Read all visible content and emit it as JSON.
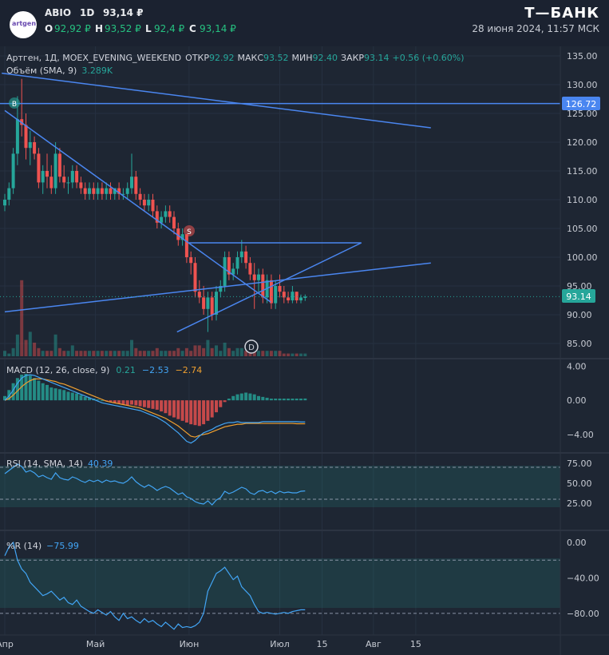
{
  "header": {
    "ticker": "ABIO",
    "interval": "1D",
    "price": "93,14 ₽",
    "logo_text": "artgen",
    "o_label": "O",
    "o_value": "92,92 ₽",
    "h_label": "H",
    "h_value": "93,52 ₽",
    "l_label": "L",
    "l_value": "92,4 ₽",
    "c_label": "C",
    "c_value": "93,14 ₽",
    "brand": "Т—БАНК",
    "datetime": "28 июня 2024, 11:57 МСК"
  },
  "legend": {
    "main_prefix": "Артген, 1Д, MOEX_EVENING_WEEKEND",
    "open_label": "ОТКР",
    "open_value": "92.92",
    "high_label": "МАКС",
    "high_value": "93.52",
    "low_label": "МИН",
    "low_value": "92.40",
    "close_label": "ЗАКР",
    "close_value": "93.14",
    "change": "+0.56 (+0.60%)",
    "volume_label": "Объём (SMA, 9)",
    "volume_value": "3.289K",
    "macd_label": "MACD (12, 26, close, 9)",
    "macd_v1": "0.21",
    "macd_v2": "−2.53",
    "macd_v3": "−2.74",
    "rsi_label": "RSI (14, SMA, 14)",
    "rsi_value": "40.39",
    "wr_label": "%R (14)",
    "wr_value": "−75.99"
  },
  "price_axis": [
    "135.00",
    "130.00",
    "125.00",
    "120.00",
    "115.00",
    "110.00",
    "105.00",
    "100.00",
    "95.00",
    "90.00",
    "85.00"
  ],
  "price_tags": {
    "level": "126.72",
    "last": "93.14"
  },
  "macd_axis": [
    "4.00",
    "0.00",
    "−4.00"
  ],
  "rsi_axis": [
    "75.00",
    "50.00",
    "25.00"
  ],
  "wr_axis": [
    "0.00",
    "−40.00",
    "−80.00"
  ],
  "time_axis": [
    "Апр",
    "Май",
    "Июн",
    "Июл",
    "15",
    "Авг",
    "15"
  ],
  "markers": {
    "b": "B",
    "s": "S",
    "d": "D"
  },
  "colors": {
    "bg": "#1e2633",
    "up": "#26a69a",
    "down": "#ef5350",
    "line": "#4a86f0",
    "rsi": "#42a5f5",
    "signal": "#f0a030"
  },
  "chart_data": {
    "type": "candlestick",
    "symbol": "ABIO",
    "ylim": [
      83,
      137
    ],
    "candles": [
      {
        "o": 109,
        "h": 111,
        "l": 108,
        "c": 110
      },
      {
        "o": 110,
        "h": 113,
        "l": 109,
        "c": 112
      },
      {
        "o": 112,
        "h": 119,
        "l": 111,
        "c": 118
      },
      {
        "o": 118,
        "h": 128,
        "l": 116,
        "c": 124
      },
      {
        "o": 124,
        "h": 131,
        "l": 121,
        "c": 123
      },
      {
        "o": 123,
        "h": 125,
        "l": 117,
        "c": 119
      },
      {
        "o": 119,
        "h": 122,
        "l": 116,
        "c": 120
      },
      {
        "o": 120,
        "h": 121,
        "l": 117,
        "c": 118
      },
      {
        "o": 118,
        "h": 119,
        "l": 112,
        "c": 113
      },
      {
        "o": 113,
        "h": 116,
        "l": 111,
        "c": 115
      },
      {
        "o": 115,
        "h": 118,
        "l": 112,
        "c": 114
      },
      {
        "o": 114,
        "h": 116,
        "l": 111,
        "c": 112
      },
      {
        "o": 112,
        "h": 120,
        "l": 111,
        "c": 118
      },
      {
        "o": 118,
        "h": 119,
        "l": 113,
        "c": 114
      },
      {
        "o": 114,
        "h": 116,
        "l": 112,
        "c": 113
      },
      {
        "o": 113,
        "h": 114,
        "l": 111,
        "c": 113
      },
      {
        "o": 113,
        "h": 116,
        "l": 112,
        "c": 115
      },
      {
        "o": 115,
        "h": 116,
        "l": 112,
        "c": 113
      },
      {
        "o": 113,
        "h": 114,
        "l": 111,
        "c": 112
      },
      {
        "o": 112,
        "h": 113,
        "l": 110,
        "c": 111
      },
      {
        "o": 111,
        "h": 113,
        "l": 110,
        "c": 112
      },
      {
        "o": 112,
        "h": 113,
        "l": 110,
        "c": 111
      },
      {
        "o": 111,
        "h": 113,
        "l": 110,
        "c": 112
      },
      {
        "o": 112,
        "h": 113,
        "l": 110,
        "c": 111
      },
      {
        "o": 111,
        "h": 113,
        "l": 110,
        "c": 112
      },
      {
        "o": 112,
        "h": 113,
        "l": 110,
        "c": 111
      },
      {
        "o": 111,
        "h": 112,
        "l": 110,
        "c": 112
      },
      {
        "o": 112,
        "h": 113,
        "l": 110,
        "c": 111
      },
      {
        "o": 111,
        "h": 112,
        "l": 110,
        "c": 111
      },
      {
        "o": 111,
        "h": 113,
        "l": 110,
        "c": 112
      },
      {
        "o": 112,
        "h": 118,
        "l": 111,
        "c": 114
      },
      {
        "o": 114,
        "h": 115,
        "l": 110,
        "c": 111
      },
      {
        "o": 111,
        "h": 112,
        "l": 109,
        "c": 110
      },
      {
        "o": 110,
        "h": 111,
        "l": 108,
        "c": 109
      },
      {
        "o": 109,
        "h": 111,
        "l": 108,
        "c": 110
      },
      {
        "o": 110,
        "h": 111,
        "l": 107,
        "c": 108
      },
      {
        "o": 108,
        "h": 109,
        "l": 105,
        "c": 106
      },
      {
        "o": 106,
        "h": 108,
        "l": 105,
        "c": 107
      },
      {
        "o": 107,
        "h": 109,
        "l": 106,
        "c": 108
      },
      {
        "o": 108,
        "h": 109,
        "l": 106,
        "c": 107
      },
      {
        "o": 107,
        "h": 108,
        "l": 104,
        "c": 105
      },
      {
        "o": 105,
        "h": 106,
        "l": 102,
        "c": 103
      },
      {
        "o": 103,
        "h": 105,
        "l": 102,
        "c": 104
      },
      {
        "o": 104,
        "h": 104,
        "l": 99,
        "c": 100
      },
      {
        "o": 100,
        "h": 101,
        "l": 97,
        "c": 99
      },
      {
        "o": 99,
        "h": 100,
        "l": 93,
        "c": 94
      },
      {
        "o": 94,
        "h": 96,
        "l": 92,
        "c": 93
      },
      {
        "o": 93,
        "h": 95,
        "l": 90,
        "c": 91
      },
      {
        "o": 91,
        "h": 94,
        "l": 87,
        "c": 93
      },
      {
        "o": 93,
        "h": 94,
        "l": 89,
        "c": 90
      },
      {
        "o": 90,
        "h": 95,
        "l": 89,
        "c": 94
      },
      {
        "o": 94,
        "h": 96,
        "l": 93,
        "c": 95
      },
      {
        "o": 95,
        "h": 101,
        "l": 94,
        "c": 100
      },
      {
        "o": 100,
        "h": 101,
        "l": 96,
        "c": 97
      },
      {
        "o": 97,
        "h": 99,
        "l": 96,
        "c": 98
      },
      {
        "o": 98,
        "h": 101,
        "l": 97,
        "c": 100
      },
      {
        "o": 100,
        "h": 103,
        "l": 99,
        "c": 101
      },
      {
        "o": 101,
        "h": 102,
        "l": 98,
        "c": 99
      },
      {
        "o": 99,
        "h": 100,
        "l": 96,
        "c": 97
      },
      {
        "o": 97,
        "h": 99,
        "l": 91,
        "c": 96
      },
      {
        "o": 96,
        "h": 98,
        "l": 94,
        "c": 97
      },
      {
        "o": 97,
        "h": 98,
        "l": 92,
        "c": 93
      },
      {
        "o": 93,
        "h": 97,
        "l": 92,
        "c": 96
      },
      {
        "o": 96,
        "h": 97,
        "l": 91,
        "c": 92
      },
      {
        "o": 92,
        "h": 96,
        "l": 91,
        "c": 95
      },
      {
        "o": 95,
        "h": 97,
        "l": 93,
        "c": 94
      },
      {
        "o": 94,
        "h": 95,
        "l": 92,
        "c": 93
      },
      {
        "o": 93,
        "h": 94,
        "l": 92,
        "c": 92.5
      },
      {
        "o": 92.5,
        "h": 95,
        "l": 92,
        "c": 94
      },
      {
        "o": 94,
        "h": 94,
        "l": 92,
        "c": 92.5
      },
      {
        "o": 92.5,
        "h": 93.5,
        "l": 92,
        "c": 93
      },
      {
        "o": 92.92,
        "h": 93.52,
        "l": 92.4,
        "c": 93.14
      }
    ],
    "volume": [
      2,
      1,
      3,
      8,
      28,
      6,
      9,
      5,
      3,
      2,
      2,
      2,
      8,
      3,
      2,
      2,
      4,
      2,
      2,
      2,
      2,
      2,
      2,
      2,
      2,
      2,
      2,
      2,
      2,
      2,
      6,
      3,
      2,
      2,
      2,
      2,
      3,
      2,
      2,
      2,
      2,
      3,
      2,
      3,
      2,
      4,
      4,
      3,
      6,
      3,
      4,
      2,
      5,
      3,
      2,
      3,
      3,
      2,
      2,
      2,
      2,
      2,
      2,
      2,
      2,
      2,
      1,
      1,
      1,
      1,
      1,
      1
    ],
    "trendlines": [
      {
        "from": {
          "x": "2024-04-01",
          "y": 125.5
        },
        "to": {
          "x": "2024-06-28",
          "y": 92.2
        }
      },
      {
        "from": {
          "x": "2024-04-01",
          "y": 90.5
        },
        "to": {
          "x": "2024-08-20",
          "y": 99
        }
      },
      {
        "from": {
          "x": "2024-06-01",
          "y": 102.5
        },
        "to": {
          "x": "2024-07-28",
          "y": 102.5
        }
      },
      {
        "from": {
          "x": "2024-05-28",
          "y": 87
        },
        "to": {
          "x": "2024-07-28",
          "y": 102.5
        }
      },
      {
        "from": {
          "x": "2024-03-31",
          "y": 132
        },
        "to": {
          "x": "2024-08-20",
          "y": 122.5
        }
      }
    ],
    "horizontal_level": 126.72,
    "last_price": 93.14,
    "macd": {
      "ylim": [
        -5.5,
        4.5
      ],
      "hist": [
        0.5,
        1.2,
        2,
        2.6,
        3,
        3.1,
        2.9,
        2.6,
        2.3,
        2,
        1.8,
        1.5,
        1.4,
        1.3,
        1.2,
        1.0,
        0.9,
        0.8,
        0.6,
        0.4,
        0.3,
        0.2,
        0.1,
        0,
        -0.1,
        -0.2,
        -0.3,
        -0.4,
        -0.5,
        -0.6,
        -0.5,
        -0.6,
        -0.7,
        -0.8,
        -0.9,
        -1,
        -1.1,
        -1.3,
        -1.5,
        -1.8,
        -2,
        -2.2,
        -2.4,
        -2.6,
        -2.8,
        -2.9,
        -3,
        -2.8,
        -2.4,
        -2,
        -1.4,
        -0.8,
        -0.2,
        0.2,
        0.5,
        0.7,
        0.8,
        0.9,
        0.8,
        0.7,
        0.5,
        0.4,
        0.3,
        0.2,
        0.2,
        0.2,
        0.2,
        0.2,
        0.2,
        0.2,
        0.2,
        0.21
      ],
      "macd_line": [
        0,
        0.5,
        1.2,
        2,
        2.6,
        2.9,
        3,
        2.9,
        2.7,
        2.5,
        2.3,
        2.1,
        1.9,
        1.7,
        1.5,
        1.3,
        1.1,
        0.9,
        0.7,
        0.5,
        0.3,
        0.1,
        -0.1,
        -0.3,
        -0.4,
        -0.5,
        -0.6,
        -0.7,
        -0.8,
        -0.9,
        -1,
        -1.1,
        -1.2,
        -1.4,
        -1.6,
        -1.8,
        -2,
        -2.3,
        -2.6,
        -3,
        -3.4,
        -3.8,
        -4.3,
        -4.8,
        -5,
        -4.7,
        -4.2,
        -3.8,
        -3.6,
        -3.4,
        -3.1,
        -2.9,
        -2.7,
        -2.6,
        -2.6,
        -2.5,
        -2.6,
        -2.6,
        -2.6,
        -2.6,
        -2.6,
        -2.5,
        -2.5,
        -2.5,
        -2.5,
        -2.5,
        -2.5,
        -2.5,
        -2.5,
        -2.5,
        -2.53,
        -2.53
      ],
      "signal_line": [
        0,
        0.2,
        0.6,
        1.1,
        1.6,
        2,
        2.3,
        2.5,
        2.5,
        2.5,
        2.4,
        2.3,
        2.2,
        2,
        1.9,
        1.7,
        1.5,
        1.3,
        1.1,
        0.9,
        0.7,
        0.5,
        0.3,
        0.1,
        -0.1,
        -0.2,
        -0.3,
        -0.4,
        -0.5,
        -0.6,
        -0.7,
        -0.8,
        -0.9,
        -1.1,
        -1.3,
        -1.5,
        -1.7,
        -1.9,
        -2.1,
        -2.4,
        -2.7,
        -3,
        -3.4,
        -3.8,
        -4.2,
        -4.3,
        -4.1,
        -4,
        -3.9,
        -3.7,
        -3.5,
        -3.3,
        -3.1,
        -3,
        -2.9,
        -2.8,
        -2.8,
        -2.7,
        -2.7,
        -2.7,
        -2.7,
        -2.7,
        -2.7,
        -2.7,
        -2.7,
        -2.7,
        -2.7,
        -2.7,
        -2.7,
        -2.74,
        -2.74,
        -2.74
      ]
    },
    "rsi": {
      "ylim": [
        0,
        85
      ],
      "bands": [
        30,
        70
      ],
      "values": [
        62,
        66,
        70,
        74,
        71,
        64,
        66,
        63,
        58,
        60,
        57,
        55,
        63,
        57,
        55,
        54,
        58,
        56,
        53,
        51,
        54,
        52,
        54,
        51,
        54,
        52,
        53,
        51,
        50,
        53,
        58,
        52,
        48,
        45,
        48,
        45,
        41,
        44,
        46,
        44,
        40,
        36,
        38,
        33,
        31,
        27,
        25,
        24,
        28,
        23,
        29,
        32,
        40,
        37,
        39,
        42,
        45,
        43,
        38,
        36,
        40,
        41,
        38,
        40,
        37,
        40,
        38,
        39,
        38,
        38,
        40,
        40.39
      ]
    },
    "williams_r": {
      "ylim": [
        -100,
        10
      ],
      "bands": [
        -20,
        -80
      ],
      "values": [
        -15,
        -5,
        0,
        -20,
        -30,
        -35,
        -45,
        -50,
        -55,
        -60,
        -58,
        -55,
        -60,
        -65,
        -62,
        -68,
        -70,
        -65,
        -72,
        -75,
        -78,
        -80,
        -76,
        -79,
        -82,
        -78,
        -84,
        -88,
        -80,
        -86,
        -84,
        -88,
        -91,
        -86,
        -90,
        -88,
        -92,
        -95,
        -90,
        -94,
        -98,
        -92,
        -96,
        -95,
        -96,
        -94,
        -90,
        -80,
        -55,
        -45,
        -35,
        -32,
        -28,
        -35,
        -42,
        -38,
        -50,
        -55,
        -60,
        -70,
        -78,
        -80,
        -79,
        -80,
        -81,
        -80,
        -79,
        -80,
        -78,
        -77,
        -76,
        -75.99
      ]
    },
    "x_ticks": [
      "Апр",
      "Май",
      "Июн",
      "Июл",
      "15",
      "Авг",
      "15"
    ]
  }
}
